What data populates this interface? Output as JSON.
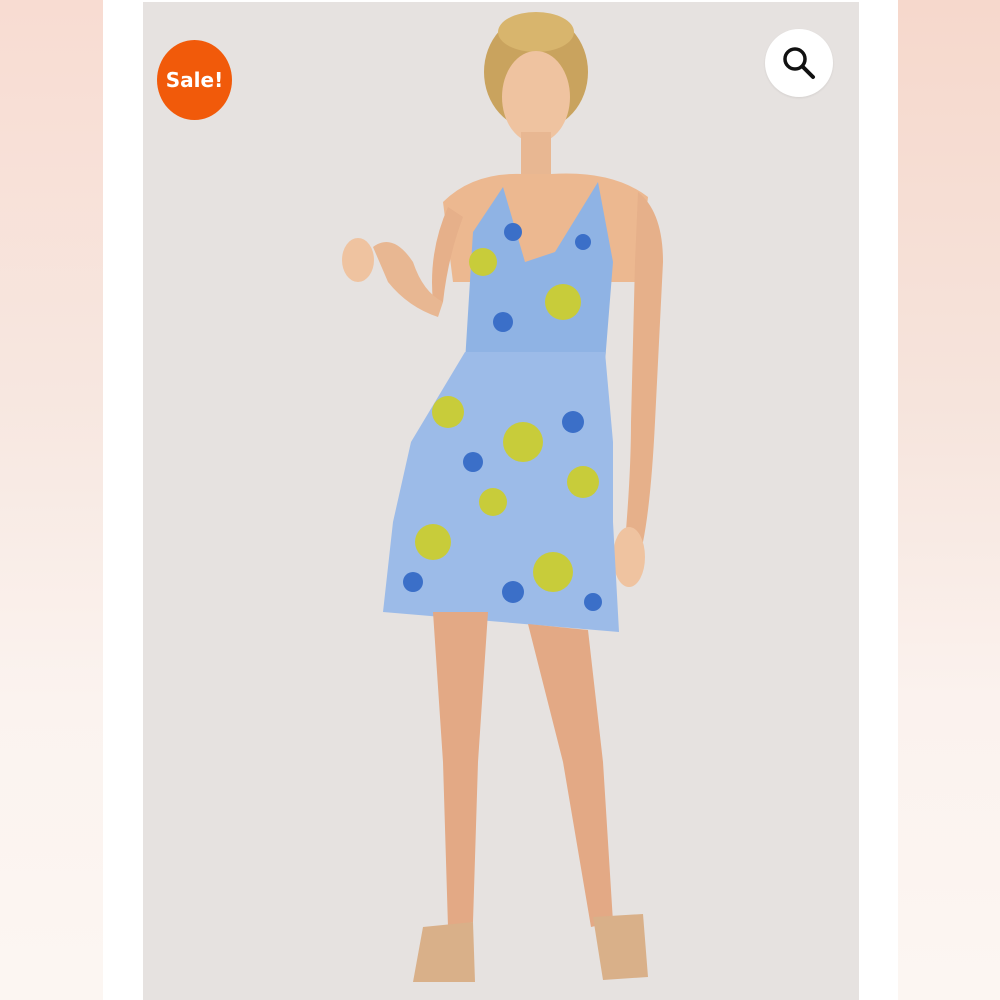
{
  "badge": {
    "label": "Sale!",
    "color": "#f15a0a"
  },
  "zoom": {
    "icon": "search-icon"
  },
  "image": {
    "subject": "product-photo",
    "background_color": "#e6e2e0"
  }
}
